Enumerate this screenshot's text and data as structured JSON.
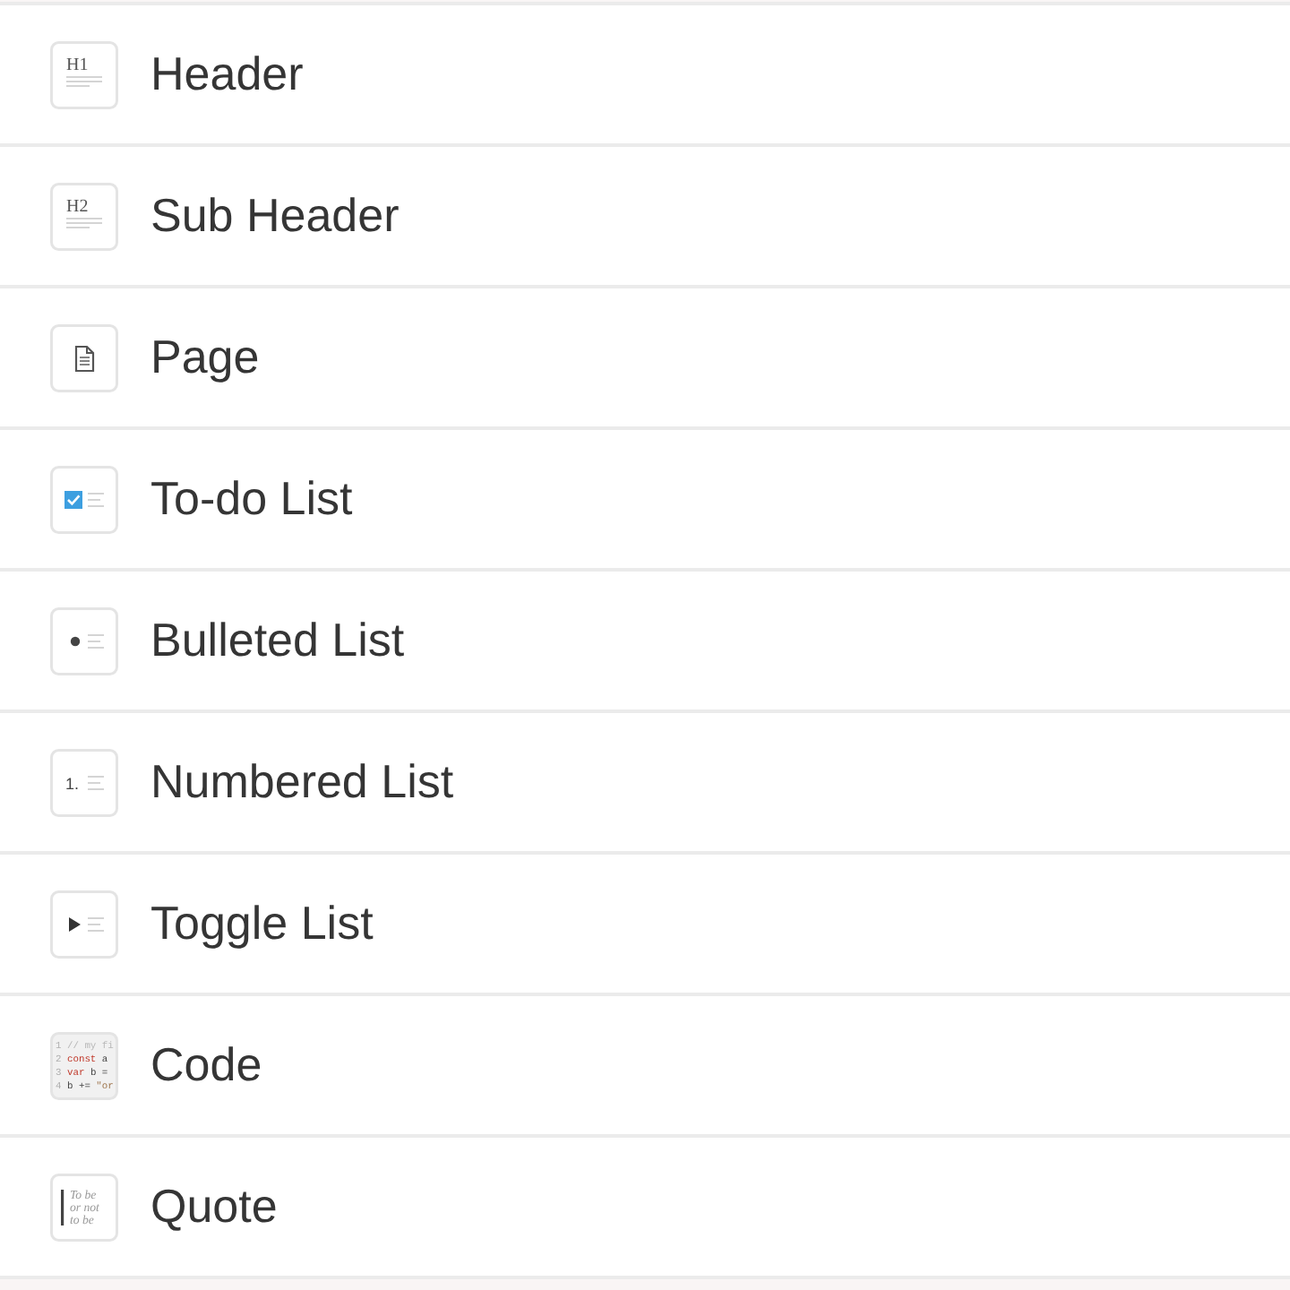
{
  "items": [
    {
      "kind": "heading",
      "label": "Header",
      "icon_text": "H1"
    },
    {
      "kind": "heading",
      "label": "Sub Header",
      "icon_text": "H2"
    },
    {
      "kind": "page",
      "label": "Page"
    },
    {
      "kind": "todo",
      "label": "To-do List"
    },
    {
      "kind": "bullet",
      "label": "Bulleted List"
    },
    {
      "kind": "numbered",
      "label": "Numbered List",
      "icon_text": "1."
    },
    {
      "kind": "toggle",
      "label": "Toggle List"
    },
    {
      "kind": "code",
      "label": "Code",
      "code_lines": [
        [
          {
            "kind": "number",
            "text": "1"
          },
          {
            "kind": "comment",
            "text": " // my fi"
          }
        ],
        [
          {
            "kind": "number",
            "text": "2"
          },
          {
            "kind": "keyword",
            "text": " const"
          },
          {
            "kind": "plain",
            "text": " a"
          }
        ],
        [
          {
            "kind": "number",
            "text": "3"
          },
          {
            "kind": "keyword",
            "text": " var"
          },
          {
            "kind": "plain",
            "text": " b ="
          }
        ],
        [
          {
            "kind": "number",
            "text": "4"
          },
          {
            "kind": "plain",
            "text": " b +="
          },
          {
            "kind": "string",
            "text": " \"or"
          }
        ]
      ]
    },
    {
      "kind": "quote",
      "label": "Quote",
      "icon_lines": [
        "To be",
        "or not",
        "to be"
      ]
    }
  ]
}
